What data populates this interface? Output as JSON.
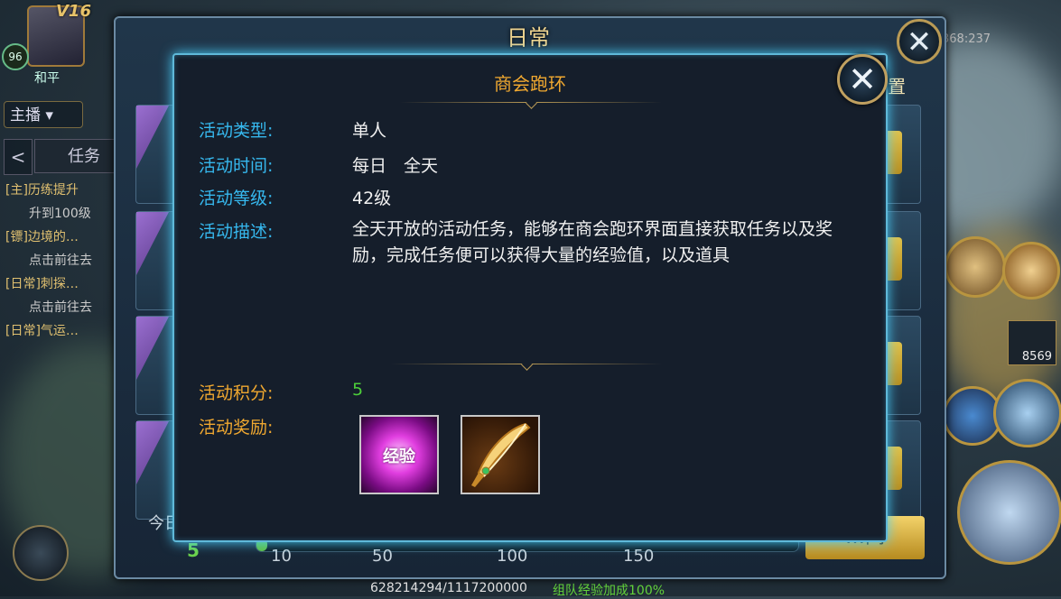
{
  "hud": {
    "vip": "V16",
    "level": "96",
    "peace_label": "和平",
    "channel": "主播",
    "channel_arrow": "▾",
    "back_arrow": "<",
    "task_tab": "任务",
    "tasks": [
      {
        "title": "[主]历练提升",
        "sub": "升到100级"
      },
      {
        "title": "[镖]边境的…",
        "sub": "点击前往去"
      },
      {
        "title": "[日常]刺探…",
        "sub": "点击前往去"
      },
      {
        "title": "[日常]气运…",
        "sub": ""
      }
    ],
    "coords": "368:237",
    "item_count": "8569"
  },
  "daily": {
    "title": "日常",
    "close_glyph": "✕",
    "settings_label": "置",
    "today_label": "今日",
    "progress": {
      "current": "5",
      "ticks": [
        "10",
        "50",
        "100",
        "150"
      ],
      "fraction": 0.02
    },
    "go_button": "…间",
    "footer_left": "628214294/1117200000",
    "footer_right": "组队经验加成100%"
  },
  "dialog": {
    "title": "商会跑环",
    "close_glyph": "✕",
    "type_label": "活动类型:",
    "type_value": "单人",
    "time_label": "活动时间:",
    "time_value": "每日　全天",
    "level_label": "活动等级:",
    "level_value": "42级",
    "desc_label": "活动描述:",
    "desc_value": "全天开放的活动任务，能够在商会跑环界面直接获取任务以及奖励，完成任务便可以获得大量的经验值，以及道具",
    "points_label": "活动积分:",
    "points_value": "5",
    "reward_label": "活动奖励:",
    "rewards": [
      {
        "name": "经验",
        "icon": "exp-orb-icon"
      },
      {
        "name": "",
        "icon": "golden-feather-icon"
      }
    ]
  },
  "colors": {
    "label_blue": "#36b8ee",
    "label_gold": "#f0a830",
    "value_green": "#4ccf3a",
    "border_glow": "#5fb9d9"
  }
}
